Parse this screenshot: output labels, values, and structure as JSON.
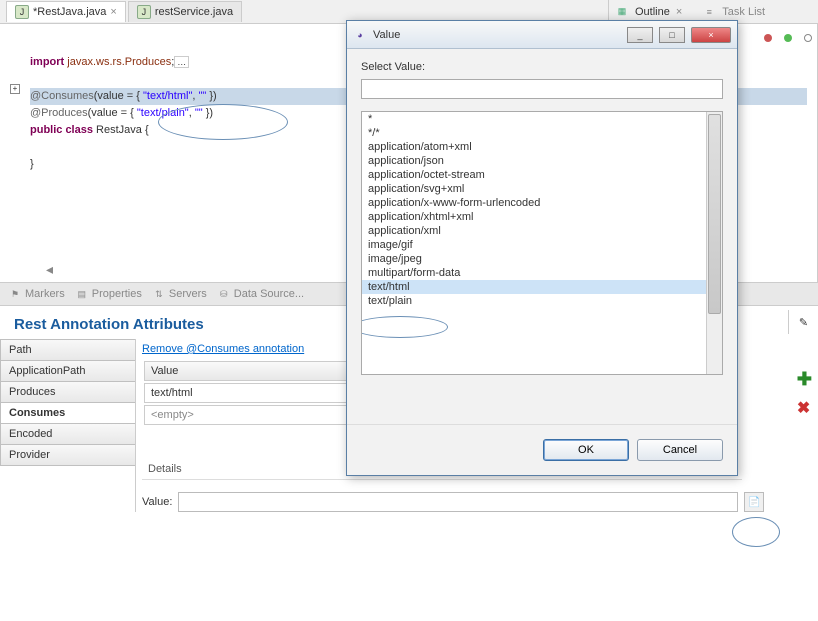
{
  "editor": {
    "tabs": [
      {
        "label": "*RestJava.java",
        "close": "×",
        "active": true
      },
      {
        "label": "restService.java",
        "close": "",
        "active": false
      }
    ],
    "code": {
      "importToggle": "+",
      "importLine": {
        "kw": "import",
        "pkg": "javax.ws.rs.Produces",
        "tail": ";"
      },
      "l1a": "@Consumes",
      "l1b": "(value = { ",
      "l1c": "\"text/html\"",
      "l1d": ", ",
      "l1e": "\"\"",
      "l1f": " })",
      "l2a": "@Produces",
      "l2b": "(value = { ",
      "l2c": "\"text/plain\"",
      "l2d": ", ",
      "l2e": "\"\"",
      "l2f": " })",
      "l3a": "public class ",
      "l3b": "RestJava {",
      "l4": "}"
    }
  },
  "outline": {
    "label": "Outline",
    "close": "×"
  },
  "tasklist": {
    "label": "Task List"
  },
  "dockItems": [
    "Markers",
    "Properties",
    "Servers",
    "Data Source..."
  ],
  "attrPanel": {
    "title": "Rest Annotation Attributes",
    "sideTabs": [
      "Path",
      "ApplicationPath",
      "Produces",
      "Consumes",
      "Encoded",
      "Provider"
    ],
    "activeTab": 3,
    "removeLink": "Remove @Consumes annotation",
    "valueHeader": "Value",
    "rows": [
      "text/html",
      "<empty>"
    ],
    "detailsLabel": "Details",
    "valueLabel": "Value:"
  },
  "dialog": {
    "title": "Value",
    "selectLabel": "Select Value:",
    "options": [
      "*",
      "*/*",
      "application/atom+xml",
      "application/json",
      "application/octet-stream",
      "application/svg+xml",
      "application/x-www-form-urlencoded",
      "application/xhtml+xml",
      "application/xml",
      "image/gif",
      "image/jpeg",
      "multipart/form-data",
      "text/html",
      "text/plain"
    ],
    "selectedIndex": 12,
    "ok": "OK",
    "cancel": "Cancel",
    "min": "_",
    "max": "□",
    "close": "×"
  },
  "icons": {
    "eclipse": "◕"
  }
}
